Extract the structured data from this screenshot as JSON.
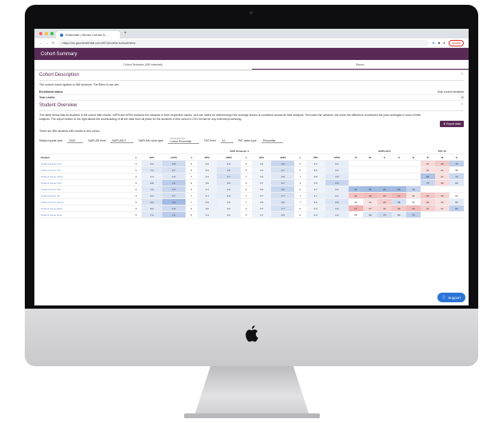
{
  "browser": {
    "tab_title": "Edmonter | Senior Cohort S...",
    "new_tab": "+",
    "url": "https://as.gooderdental.com/rl/Cohort/sr/school/view",
    "update_label": "Update"
  },
  "app": {
    "header_title": "Cohort Summary"
  },
  "steps": [
    {
      "label": "Cohort Selection (365 selected)"
    },
    {
      "label": "Report"
    }
  ],
  "cohort_description": {
    "title": "Cohort Description",
    "text": "The current cohort applies to 365 students. The filters in use are:",
    "rows": [
      {
        "label": "Enrollment status",
        "value": "Only current students"
      },
      {
        "label": "Year Levels",
        "value": "12"
      }
    ]
  },
  "student_overview": {
    "title": "Student Overview",
    "description": "This table below lists all students in the cohort with results. nGPA and nRPA measure the variance in their respective values, and are useful for determining if the average shown is consistent across all their subjects. The lower the variance, the lower the difference is between the point averages in each of their subjects. The export button to the right allows the downloading of all the data from all years for the students in this cohort in CSV format for any external processing.",
    "count_text": "There are 365 students with results in this cohort.",
    "export_label": "Export data"
  },
  "filters": {
    "grade_year_label": "Subject grade year",
    "grade_year_value": "2020",
    "naplan_level_label": "NAPLAN level",
    "naplan_level_value": "NAPLAN 9",
    "naplan_type_label": "NAPLAN value type",
    "naplan_type_small": "Comparison type",
    "naplan_type_value": "Cohort Percentile",
    "pat_level_label": "PAT level",
    "pat_level_value": "10",
    "pat_type_label": "PAT value type",
    "pat_type_value": "Percentile"
  },
  "table": {
    "group_headers": {
      "semester": "2020 Semester 1",
      "naplan": "NAPLAN 9",
      "pat": "PAT 10"
    },
    "columns": [
      "Student",
      "n",
      "GPA",
      "nGPA",
      "n",
      "RPA",
      "nRPA",
      "n",
      "EPA",
      "nEPA",
      "n",
      "PPA",
      "nPPA",
      "R",
      "W",
      "S",
      "G",
      "N",
      "R",
      "M",
      "S"
    ],
    "rows": [
      [
        "Student Name One",
        "5",
        "5.6",
        "0.8",
        "5",
        "3.6",
        "0.4",
        "5",
        "3.4",
        "0.9",
        "5",
        "3.2",
        "0.4",
        "",
        "",
        "",
        "",
        "",
        "37",
        "28",
        "79"
      ],
      [
        "Student Name Two",
        "5",
        "7.2",
        "0.7",
        "5",
        "3.4",
        "0.6",
        "5",
        "3.2",
        "0.7",
        "5",
        "3.5",
        "0.4",
        "",
        "",
        "",
        "",
        "",
        "43",
        "41",
        "58"
      ],
      [
        "Student Name Three",
        "6",
        "4.3",
        "0.5",
        "7",
        "3.3",
        "0.7",
        "7",
        "3.4",
        "0.5",
        "7",
        "3.5",
        "0.5",
        "",
        "",
        "",
        "",
        "",
        "90",
        "41",
        "74"
      ],
      [
        "Student Name Four",
        "6",
        "6.8",
        "1.1",
        "6",
        "3.6",
        "0.5",
        "6",
        "3.7",
        "0.7",
        "6",
        "3.5",
        "0.9",
        "",
        "",
        "",
        "",
        "",
        "75",
        "39",
        "63"
      ],
      [
        "Student Name Five",
        "6",
        "7.0",
        "0.9",
        "6",
        "4.1",
        "0.4",
        "6",
        "3.6",
        "0.9",
        "6",
        "3.7",
        "0.4",
        "92",
        "95",
        "95",
        "96",
        "78",
        "",
        "",
        ""
      ],
      [
        "Student Name Six",
        "6",
        "6.2",
        "0.7",
        "7",
        "4.7",
        "0.4",
        "7",
        "3.7",
        "0.7",
        "7",
        "4.7",
        "0.4",
        "24",
        "20",
        "23",
        "17",
        "44",
        "25",
        "35",
        "53"
      ],
      [
        "Student Name Seven",
        "5",
        "9.0",
        "1.6",
        "7",
        "4.9",
        "0.3",
        "7",
        "3.5",
        "0.6",
        "7",
        "3.9",
        "0.6",
        "46",
        "44",
        "29",
        "68",
        "46",
        "36",
        "43",
        "60"
      ],
      [
        "Student Name Eight",
        "6",
        "6.6",
        "0.8",
        "6",
        "4.5",
        "0.3",
        "6",
        "3.7",
        "0.7",
        "6",
        "3.3",
        "0.5",
        "12",
        "37",
        "33",
        "26",
        "18",
        "31",
        "41",
        "80"
      ],
      [
        "Student Name Nine",
        "5",
        "7.2",
        "1.1",
        "5",
        "4.3",
        "0.3",
        "5",
        "3.7",
        "0.5",
        "5",
        "4.2",
        "0.4",
        "55",
        "63",
        "70",
        "60",
        "79",
        "",
        "",
        ""
      ]
    ]
  },
  "support": {
    "label": "Support"
  }
}
